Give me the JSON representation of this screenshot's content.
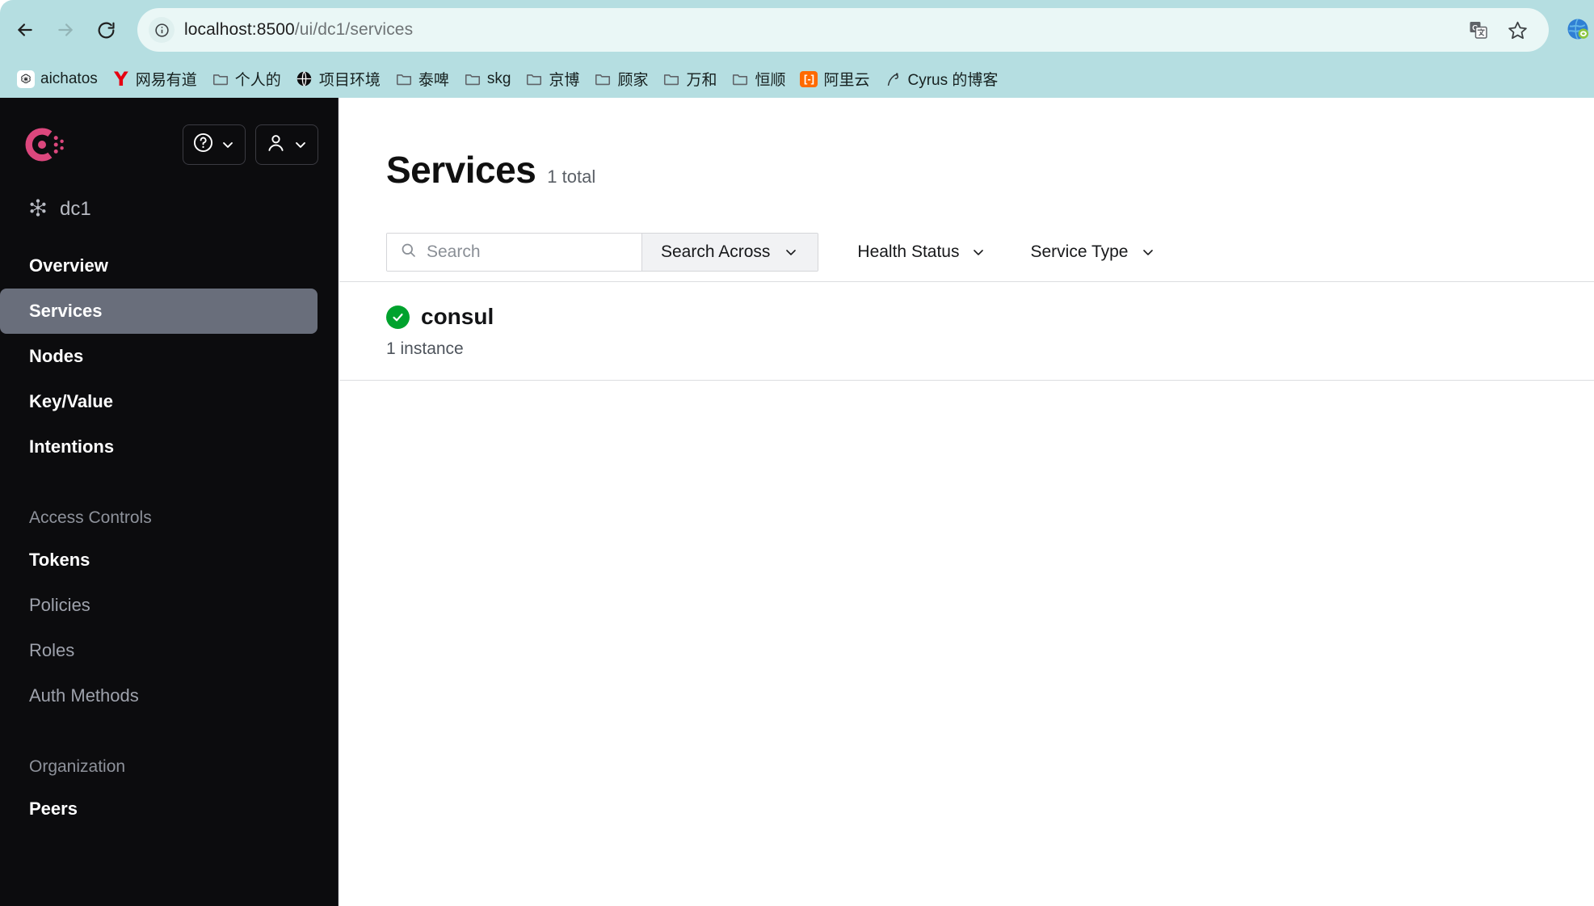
{
  "browser": {
    "back_label": "Back",
    "forward_label": "Forward",
    "reload_label": "Reload",
    "url_host": "localhost:8500",
    "url_path": "/ui/dc1/services",
    "site_info_icon": "info-circle-icon",
    "translate_icon": "translate-icon",
    "bookmark_star_icon": "star-icon",
    "extension_icon": "globe-extension-icon",
    "bookmarks": [
      {
        "label": "aichatos",
        "icon": "openai-icon"
      },
      {
        "label": "网易有道",
        "icon": "youdao-icon"
      },
      {
        "label": "个人的",
        "icon": "folder-icon"
      },
      {
        "label": "项目环境",
        "icon": "globe-icon"
      },
      {
        "label": "泰啤",
        "icon": "folder-icon"
      },
      {
        "label": "skg",
        "icon": "folder-icon"
      },
      {
        "label": "京博",
        "icon": "folder-icon"
      },
      {
        "label": "顾家",
        "icon": "folder-icon"
      },
      {
        "label": "万和",
        "icon": "folder-icon"
      },
      {
        "label": "恒顺",
        "icon": "folder-icon"
      },
      {
        "label": "阿里云",
        "icon": "aliyun-icon"
      },
      {
        "label": "Cyrus 的博客",
        "icon": "blog-icon"
      }
    ]
  },
  "sidebar": {
    "logo_icon": "consul-logo-icon",
    "help_button": {
      "icon": "question-circle-icon",
      "chevron": "chevron-down-icon"
    },
    "user_button": {
      "icon": "user-icon",
      "chevron": "chevron-down-icon"
    },
    "datacenter": {
      "icon": "datacenter-icon",
      "name": "dc1"
    },
    "nav": [
      {
        "label": "Overview",
        "state": "primary"
      },
      {
        "label": "Services",
        "state": "active"
      },
      {
        "label": "Nodes",
        "state": "primary"
      },
      {
        "label": "Key/Value",
        "state": "primary"
      },
      {
        "label": "Intentions",
        "state": "primary"
      }
    ],
    "access_controls_heading": "Access Controls",
    "access_controls": [
      {
        "label": "Tokens",
        "state": "primary"
      },
      {
        "label": "Policies",
        "state": "muted"
      },
      {
        "label": "Roles",
        "state": "muted"
      },
      {
        "label": "Auth Methods",
        "state": "muted"
      }
    ],
    "organization_heading": "Organization",
    "organization": [
      {
        "label": "Peers",
        "state": "primary"
      }
    ]
  },
  "main": {
    "title": "Services",
    "total": "1 total",
    "filters": {
      "search_placeholder": "Search",
      "search_value": "",
      "search_icon": "search-icon",
      "search_across_label": "Search Across",
      "health_status_label": "Health Status",
      "service_type_label": "Service Type"
    },
    "services": [
      {
        "name": "consul",
        "instances": "1 instance",
        "health": "passing",
        "health_icon": "check-circle-icon"
      }
    ]
  },
  "colors": {
    "browser_chrome": "#b5dee1",
    "omnibox": "#eaf7f6",
    "sidebar_bg": "#0c0c0e",
    "sidebar_active": "#696e7b",
    "consul_brand": "#dc477d",
    "health_passing": "#00a22d",
    "aliyun_orange": "#ff6a00",
    "youdao_red": "#e60012"
  }
}
